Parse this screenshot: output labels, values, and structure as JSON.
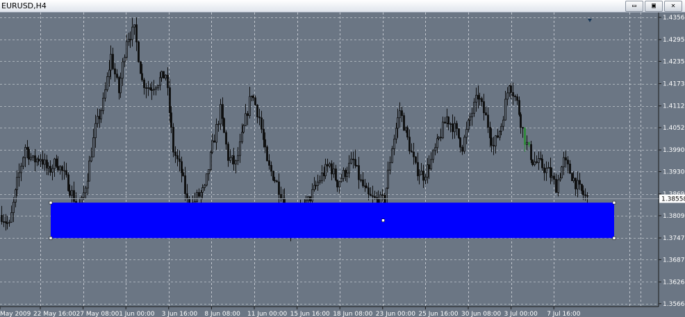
{
  "window": {
    "title": "EURUSD,H4",
    "buttons": {
      "minimize": "▭",
      "maximize": "▣",
      "close": "✕"
    }
  },
  "colors": {
    "background": "#6b7684",
    "grid": "#dfe3e8",
    "candle": "#0c0c0c",
    "rectangle": "#0000ff",
    "price_line": "#98a0aa",
    "price_label_bg": "#ffffff",
    "last_bars": "#2e8b3a"
  },
  "chart_data": {
    "type": "candlestick",
    "symbol": "EURUSD",
    "timeframe": "H4",
    "ylim": [
      1.3558,
      1.43565
    ],
    "grid": true,
    "y_ticks": [
      "1.43565",
      "1.42950",
      "1.42350",
      "1.41735",
      "1.41120",
      "1.40520",
      "1.39905",
      "1.39305",
      "1.38690",
      "1.38090",
      "1.37475",
      "1.36875",
      "1.36260",
      "1.35660"
    ],
    "x_ticks": [
      "May 2009",
      "22 May 16:00",
      "27 May 08:00",
      "1 Jun 00:00",
      "3 Jun 16:00",
      "8 Jun 08:00",
      "11 Jun 00:00",
      "15 Jun 16:00",
      "18 Jun 08:00",
      "23 Jun 00:00",
      "25 Jun 16:00",
      "30 Jun 08:00",
      "3 Jul 00:00",
      "7 Jul 16:00"
    ],
    "current_price": "1.38558",
    "rectangle": {
      "price_top": 1.3845,
      "price_bottom": 1.3747
    },
    "close_path": [
      [
        0,
        1.381
      ],
      [
        4,
        1.378
      ],
      [
        8,
        1.39
      ],
      [
        12,
        1.4
      ],
      [
        16,
        1.396
      ],
      [
        20,
        1.397
      ],
      [
        24,
        1.393
      ],
      [
        28,
        1.396
      ],
      [
        32,
        1.392
      ],
      [
        36,
        1.387
      ],
      [
        40,
        1.382
      ],
      [
        44,
        1.392
      ],
      [
        48,
        1.405
      ],
      [
        52,
        1.412
      ],
      [
        56,
        1.425
      ],
      [
        60,
        1.415
      ],
      [
        64,
        1.43
      ],
      [
        68,
        1.432
      ],
      [
        72,
        1.418
      ],
      [
        76,
        1.416
      ],
      [
        80,
        1.418
      ],
      [
        84,
        1.42
      ],
      [
        88,
        1.399
      ],
      [
        92,
        1.393
      ],
      [
        96,
        1.382
      ],
      [
        100,
        1.386
      ],
      [
        104,
        1.388
      ],
      [
        108,
        1.4
      ],
      [
        112,
        1.41
      ],
      [
        116,
        1.397
      ],
      [
        120,
        1.395
      ],
      [
        124,
        1.405
      ],
      [
        128,
        1.415
      ],
      [
        132,
        1.408
      ],
      [
        136,
        1.395
      ],
      [
        140,
        1.391
      ],
      [
        144,
        1.386
      ],
      [
        148,
        1.377
      ],
      [
        152,
        1.381
      ],
      [
        156,
        1.384
      ],
      [
        160,
        1.388
      ],
      [
        164,
        1.392
      ],
      [
        168,
        1.395
      ],
      [
        172,
        1.39
      ],
      [
        176,
        1.393
      ],
      [
        180,
        1.396
      ],
      [
        184,
        1.39
      ],
      [
        188,
        1.386
      ],
      [
        192,
        1.385
      ],
      [
        196,
        1.385
      ],
      [
        200,
        1.4
      ],
      [
        204,
        1.41
      ],
      [
        208,
        1.402
      ],
      [
        212,
        1.394
      ],
      [
        216,
        1.392
      ],
      [
        220,
        1.396
      ],
      [
        224,
        1.402
      ],
      [
        228,
        1.408
      ],
      [
        232,
        1.405
      ],
      [
        236,
        1.4
      ],
      [
        240,
        1.408
      ],
      [
        244,
        1.414
      ],
      [
        248,
        1.408
      ],
      [
        252,
        1.4
      ],
      [
        256,
        1.406
      ],
      [
        260,
        1.418
      ],
      [
        264,
        1.412
      ],
      [
        268,
        1.402
      ],
      [
        272,
        1.396
      ],
      [
        276,
        1.395
      ],
      [
        280,
        1.393
      ],
      [
        284,
        1.389
      ],
      [
        288,
        1.396
      ],
      [
        292,
        1.392
      ],
      [
        296,
        1.388
      ],
      [
        300,
        1.3855
      ]
    ]
  }
}
